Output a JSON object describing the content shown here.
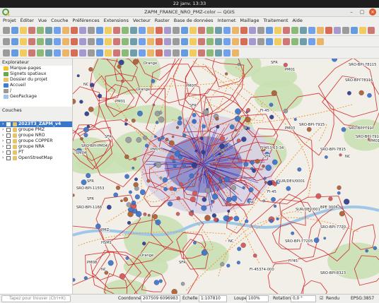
{
  "system": {
    "clock": "22 janv.  13:33"
  },
  "window": {
    "title": "ZAPM_FRANCE_NRO_PMZ-color — QGIS"
  },
  "menu": [
    "Projet",
    "Éditer",
    "Vue",
    "Couche",
    "Préférences",
    "Extensions",
    "Vecteur",
    "Raster",
    "Base de données",
    "Internet",
    "Maillage",
    "Traitement",
    "Aide"
  ],
  "explorer": {
    "title": "Explorateur",
    "items": [
      "Marque-pages",
      "Signets spatiaux",
      "Dossier du projet",
      "Accueil",
      "/",
      "GeoPackage"
    ]
  },
  "layers": {
    "title": "Couches",
    "items": [
      {
        "label": "2023T3_ZAPM_v4",
        "selected": true
      },
      {
        "label": "groupe PMZ"
      },
      {
        "label": "groupe NRO"
      },
      {
        "label": "groupe COPPER"
      },
      {
        "label": "groupe NRA"
      },
      {
        "label": "PT"
      },
      {
        "label": "OpenStreetMap"
      }
    ]
  },
  "map": {
    "labels": [
      "Orange",
      "SFR",
      "SRO-BPI-78115",
      "PM01",
      "SRO-BPI-78116",
      "NC",
      "Orange",
      "PM07",
      "SRO-BPI-7917",
      "PM03",
      "SRO-BPI-7917253",
      "PM01",
      "FI-45",
      "PM07",
      "SRO-BPI-7915",
      "FI-453-63-34",
      "SFR",
      "SRO-BPI-PM04",
      "PM04",
      "SFR",
      "SFR",
      "SRO-BPI-7815",
      "SUR/DEV/0001",
      "SFR",
      "SRO-BPI-11553",
      "SFR",
      "SRO-BPI-1168",
      "PM01",
      "NC",
      "SUR/DEV/001",
      "BPE 0006",
      "SRO-BPI-7720",
      "NC",
      "FI-45",
      "SRO-BPI-77205",
      "FI-45374-000",
      "SRO-BPI-8323",
      "PMZ",
      "HSM1",
      "NC",
      "SFR",
      "Orange",
      "PM08",
      "FI-45-",
      "NC"
    ]
  },
  "status": {
    "search_placeholder": "Tapez pour trouver (Ctrl+K)",
    "coord_label": "Coordonnée",
    "coord_value": "207509 6096983",
    "scale_label": "Échelle",
    "scale_value": "1:107810",
    "zoom_label": "Loupe",
    "zoom_value": "100%",
    "rotation_label": "Rotation",
    "rotation_value": "0,0 °",
    "render_label": "Rendu",
    "crs_label": "EPSG:3857"
  }
}
